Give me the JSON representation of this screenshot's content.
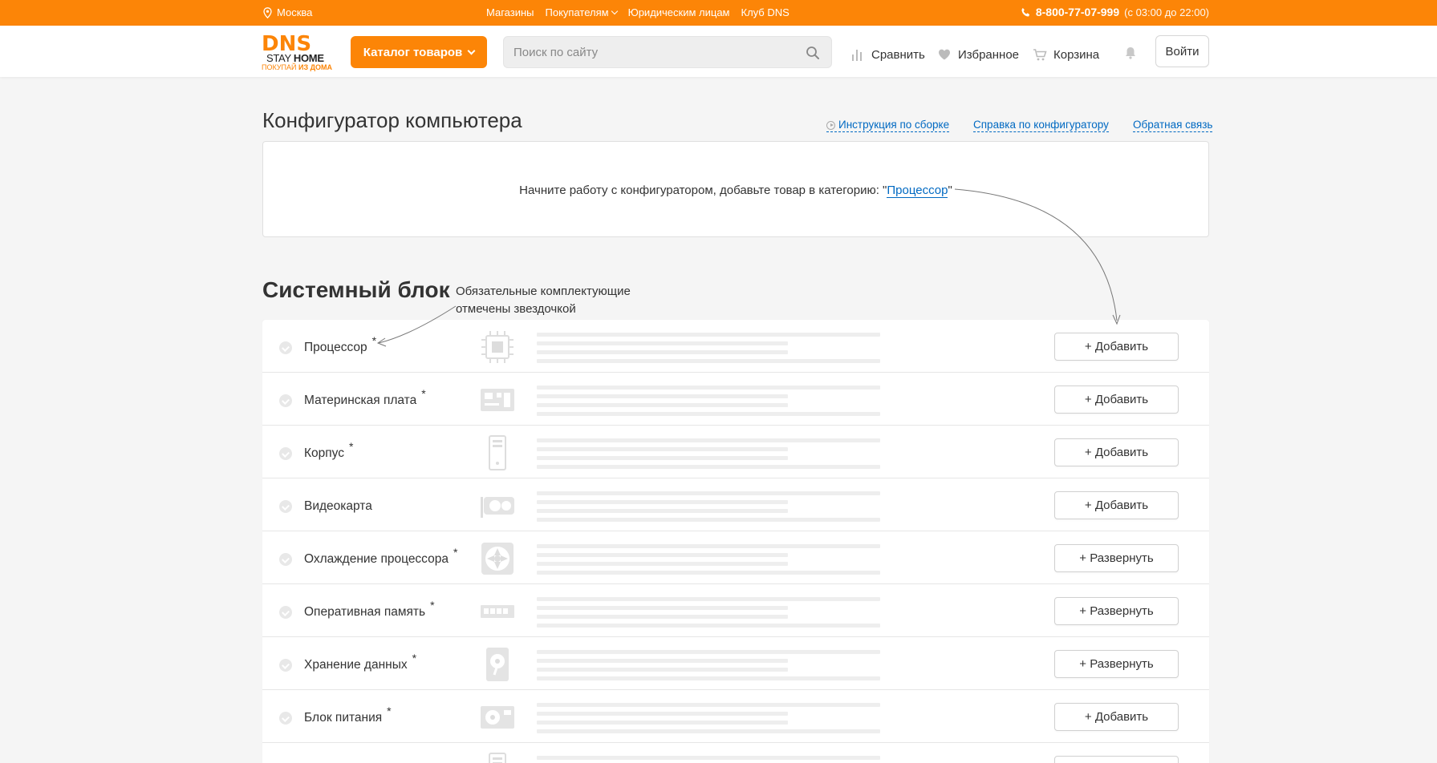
{
  "topbar": {
    "city": "Москва",
    "nav": [
      "Магазины",
      "Покупателям",
      "Юридическим лицам",
      "Клуб DNS"
    ],
    "phone": "8-800-77-07-999",
    "hours": "(с 03:00 до 22:00)",
    "bg_color": "#fc8507"
  },
  "header": {
    "logo_main": "DNS",
    "logo_stay": "STAY",
    "logo_home": "HOME",
    "logo_tag_a": "ПОКУПАЙ",
    "logo_tag_b": "ИЗ ДОМА",
    "catalog_label": "Каталог товаров",
    "search_placeholder": "Поиск по сайту",
    "compare_label": "Сравнить",
    "favorites_label": "Избранное",
    "cart_label": "Корзина",
    "login_label": "Войти"
  },
  "page": {
    "title": "Конфигуратор компьютера",
    "links": [
      "Инструкция по сборке",
      "Справка по конфигуратору",
      "Обратная связь"
    ],
    "start_prefix": "Начните работу с конфигуратором, добавьте товар в категорию: \"",
    "start_link": "Процессор",
    "start_suffix": "\"",
    "link_color": "#0069c2"
  },
  "section": {
    "title": "Системный блок",
    "hint": "Обязательные комплектующие отмечены звездочкой",
    "rows": [
      {
        "name": "Процессор",
        "required": true,
        "icon": "cpu-icon",
        "button": "+ Добавить"
      },
      {
        "name": "Материнская плата",
        "required": true,
        "icon": "motherboard-icon",
        "button": "+ Добавить"
      },
      {
        "name": "Корпус",
        "required": true,
        "icon": "case-icon",
        "button": "+ Добавить"
      },
      {
        "name": "Видеокарта",
        "required": false,
        "icon": "gpu-icon",
        "button": "+ Добавить"
      },
      {
        "name": "Охлаждение процессора",
        "required": true,
        "icon": "cooler-icon",
        "button": "+ Развернуть"
      },
      {
        "name": "Оперативная память",
        "required": true,
        "icon": "ram-icon",
        "button": "+ Развернуть"
      },
      {
        "name": "Хранение данных",
        "required": true,
        "icon": "hdd-icon",
        "button": "+ Развернуть"
      },
      {
        "name": "Блок питания",
        "required": true,
        "icon": "psu-icon",
        "button": "+ Добавить"
      }
    ],
    "required_mark": "*"
  }
}
